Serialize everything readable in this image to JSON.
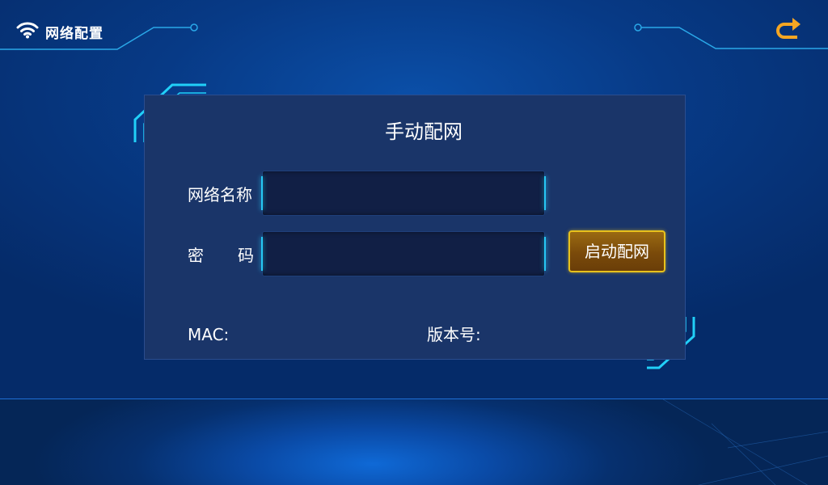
{
  "header": {
    "title": "网络配置",
    "wifi_icon": "wifi-icon",
    "back_icon": "return-arrow-icon",
    "back_icon_color": "#f5a623"
  },
  "panel": {
    "title": "手动配网",
    "ssid_label": "网络名称",
    "ssid_value": "",
    "password_label_1": "密",
    "password_label_2": "码",
    "password_value": "",
    "start_button_label": "启动配网",
    "mac_label": "MAC:",
    "mac_value": "",
    "version_label": "版本号:",
    "version_value": ""
  },
  "colors": {
    "background": "#073a86",
    "panel": "#1a3569",
    "accent_cyan": "#27c8f5",
    "button_border": "#e8c21c",
    "button_fill": "#7a4a0a"
  }
}
